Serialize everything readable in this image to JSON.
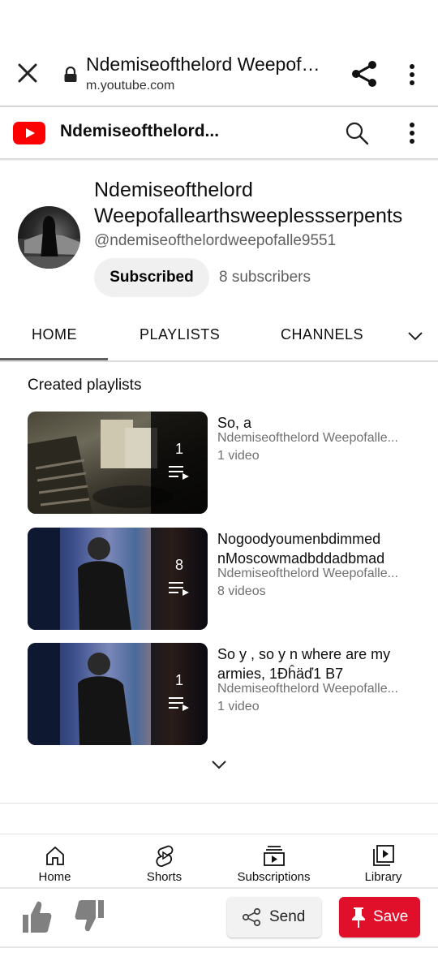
{
  "browser": {
    "title": "Ndemiseofthelord Weepofal...",
    "url": "m.youtube.com"
  },
  "header": {
    "channel_short": "Ndemiseofthelord..."
  },
  "channel": {
    "name": "Ndemiseofthelord Weepofallearthsweeplessserpents",
    "handle": "@ndemiseofthelordweepofalle9551",
    "subscribe_label": "Subscribed",
    "subscribers": "8 subscribers"
  },
  "tabs": [
    {
      "label": "HOME"
    },
    {
      "label": "PLAYLISTS"
    },
    {
      "label": "CHANNELS"
    }
  ],
  "section_title": "Created playlists",
  "playlists": [
    {
      "title": "So, a",
      "channel": "Ndemiseofthelord Weepofalle...",
      "count": "1",
      "videos": "1 video"
    },
    {
      "title": "Nogoodyoumenbdimmed nMoscowmadbddadbmad",
      "channel": "Ndemiseofthelord Weepofalle...",
      "count": "8",
      "videos": "8 videos"
    },
    {
      "title": "So y , so y n where are my armies, 1Ðĥäď1 B7",
      "channel": "Ndemiseofthelord Weepofalle...",
      "count": "1",
      "videos": "1 video"
    }
  ],
  "bottom_nav": [
    {
      "label": "Home",
      "icon": "home-icon"
    },
    {
      "label": "Shorts",
      "icon": "shorts-icon"
    },
    {
      "label": "Subscriptions",
      "icon": "subscriptions-icon"
    },
    {
      "label": "Library",
      "icon": "library-icon"
    }
  ],
  "actions": {
    "send_label": "Send",
    "save_label": "Save"
  },
  "colors": {
    "brand_red": "#ff0000",
    "save_red": "#e0102a"
  }
}
